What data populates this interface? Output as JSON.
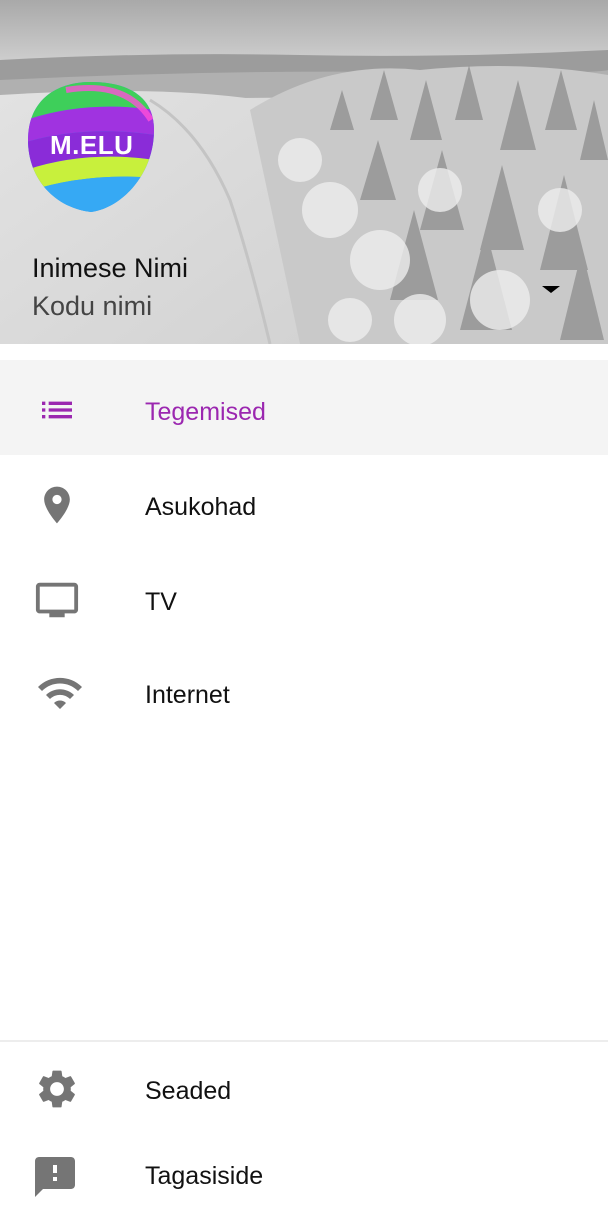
{
  "header": {
    "logo_text": "M.ELU",
    "user_name": "Inimese Nimi",
    "home_name": "Kodu nimi"
  },
  "menu": {
    "items": [
      {
        "label": "Tegemised",
        "icon": "list-icon",
        "active": true
      },
      {
        "label": "Asukohad",
        "icon": "location-pin-icon",
        "active": false
      },
      {
        "label": "TV",
        "icon": "tv-icon",
        "active": false
      },
      {
        "label": "Internet",
        "icon": "wifi-icon",
        "active": false
      }
    ],
    "footer_items": [
      {
        "label": "Seaded",
        "icon": "gear-icon"
      },
      {
        "label": "Tagasiside",
        "icon": "feedback-icon"
      }
    ]
  },
  "colors": {
    "accent": "#9b27b0",
    "icon_gray": "#757575",
    "active_bg": "#f4f4f4"
  }
}
